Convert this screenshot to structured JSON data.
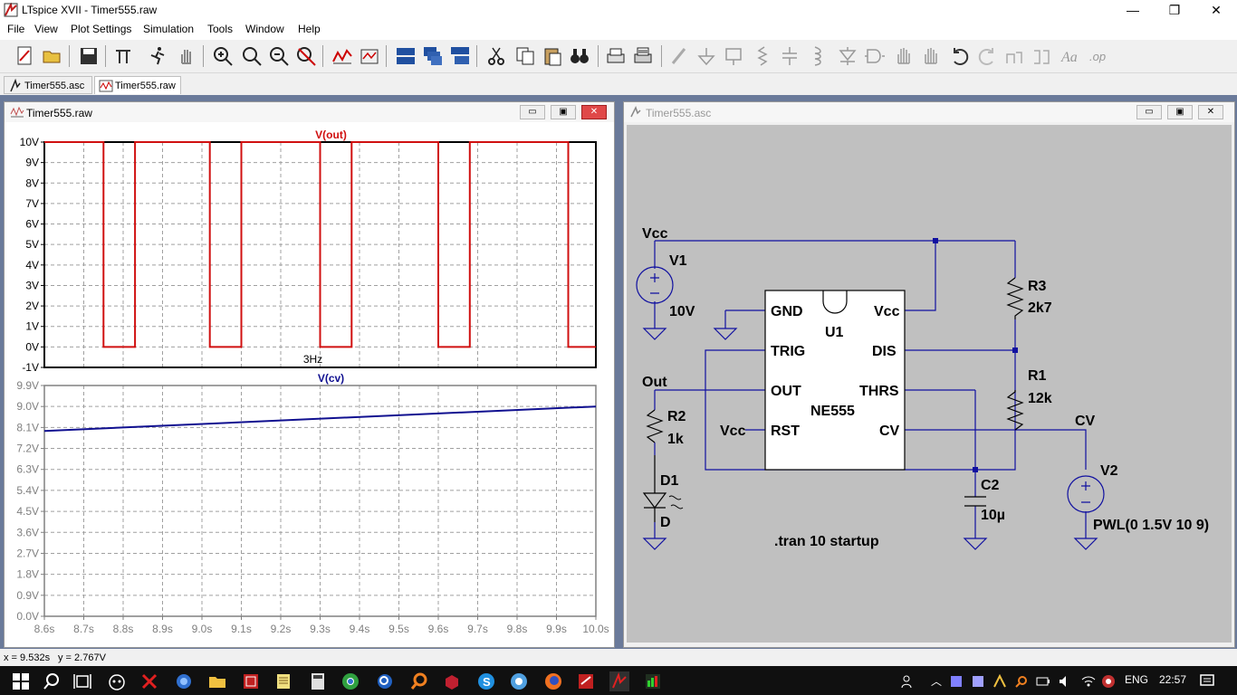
{
  "window": {
    "title": "LTspice XVII - Timer555.raw",
    "minimize": "—",
    "restore": "❐",
    "close": "✕"
  },
  "menu": [
    "File",
    "View",
    "Plot Settings",
    "Simulation",
    "Tools",
    "Window",
    "Help"
  ],
  "tabs": [
    {
      "label": "Timer555.asc",
      "icon": "schematic-icon"
    },
    {
      "label": "Timer555.raw",
      "icon": "waveform-icon"
    }
  ],
  "waveform_window": {
    "title": "Timer555.raw",
    "minimize": "▭",
    "restore": "▣",
    "close": "✕"
  },
  "schematic_window": {
    "title": "Timer555.asc",
    "minimize": "▭",
    "restore": "▣",
    "close": "✕"
  },
  "chart_data": [
    {
      "type": "line",
      "title": "V(out)",
      "x_ticks": [],
      "y_ticks": [
        "10V",
        "9V",
        "8V",
        "7V",
        "6V",
        "5V",
        "4V",
        "3V",
        "2V",
        "1V",
        "0V",
        "-1V"
      ],
      "ylim": [
        -1,
        10
      ],
      "xlim": [
        8.6,
        10.0
      ],
      "annotation": "3Hz",
      "series": [
        {
          "name": "V(out)",
          "color": "#d01010",
          "x": [
            8.6,
            8.75,
            8.75,
            8.83,
            8.83,
            9.02,
            9.02,
            9.1,
            9.1,
            9.3,
            9.3,
            9.38,
            9.38,
            9.6,
            9.6,
            9.68,
            9.68,
            9.93,
            9.93,
            10.0
          ],
          "y": [
            10,
            10,
            0,
            0,
            10,
            10,
            0,
            0,
            10,
            10,
            0,
            0,
            10,
            10,
            0,
            0,
            10,
            10,
            0,
            0
          ]
        }
      ]
    },
    {
      "type": "line",
      "title": "V(cv)",
      "y_ticks": [
        "9.9V",
        "9.0V",
        "8.1V",
        "7.2V",
        "6.3V",
        "5.4V",
        "4.5V",
        "3.6V",
        "2.7V",
        "1.8V",
        "0.9V",
        "0.0V"
      ],
      "x_ticks": [
        "8.6s",
        "8.7s",
        "8.8s",
        "8.9s",
        "9.0s",
        "9.1s",
        "9.2s",
        "9.3s",
        "9.4s",
        "9.5s",
        "9.6s",
        "9.7s",
        "9.8s",
        "9.9s",
        "10.0s"
      ],
      "ylim": [
        0,
        9.9
      ],
      "xlim": [
        8.6,
        10.0
      ],
      "series": [
        {
          "name": "V(cv)",
          "color": "#101090",
          "x": [
            8.6,
            10.0
          ],
          "y": [
            7.95,
            9.0
          ]
        }
      ]
    }
  ],
  "schematic": {
    "labels": {
      "vcc_top": "Vcc",
      "v1": "V1",
      "v1_val": "10V",
      "r3": "R3",
      "r3_val": "2k7",
      "r1": "R1",
      "r1_val": "12k",
      "r2": "R2",
      "r2_val": "1k",
      "d1": "D1",
      "d1_val": "D",
      "c2": "C2",
      "c2_val": "10µ",
      "v2": "V2",
      "v2_val": "PWL(0 1.5V 10 9)",
      "out": "Out",
      "cv": "CV",
      "vcc_rst": "Vcc",
      "u1": "U1",
      "ne555": "NE555",
      "pin_gnd": "GND",
      "pin_vcc": "Vcc",
      "pin_trig": "TRIG",
      "pin_dis": "DIS",
      "pin_out": "OUT",
      "pin_thrs": "THRS",
      "pin_rst": "RST",
      "pin_cv": "CV",
      "directive": ".tran 10 startup"
    }
  },
  "status": {
    "x": "x = 9.532s",
    "y": "y = 2.767V"
  },
  "taskbar": {
    "lang": "ENG",
    "time": "22:57"
  }
}
